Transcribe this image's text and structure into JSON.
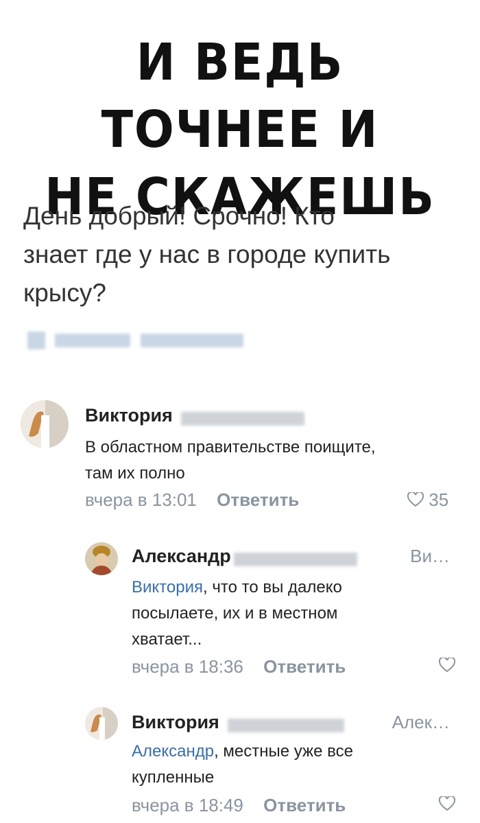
{
  "headline": {
    "line1": "И ВЕДЬ ТОЧНЕЕ И",
    "line2": "НЕ СКАЖЕШЬ"
  },
  "post": {
    "text_line1": "День добрый! Срочно! Кто",
    "text_line2": "знает где у нас в городе купить",
    "text_line3": "крысу?"
  },
  "comments": [
    {
      "author": "Виктория",
      "text_line1": "В областном правительстве поищите,",
      "text_line2": "там их полно",
      "time": "вчера в 13:01",
      "reply_label": "Ответить",
      "likes": "35"
    },
    {
      "author": "Александр",
      "reply_to": "Ви…",
      "mention": "Виктория",
      "text_line1_rest": ", что то вы далеко",
      "text_line2": "посылаете, их и в местном",
      "text_line3": "хватает...",
      "time": "вчера в 18:36",
      "reply_label": "Ответить"
    },
    {
      "author": "Виктория",
      "reply_to": "Алек…",
      "mention": "Александр",
      "text_line1_rest": ", местные уже все",
      "text_line2": "купленные",
      "time": "вчера в 18:49",
      "reply_label": "Ответить"
    }
  ],
  "colors": {
    "mention": "#3a6ea8",
    "meta": "#8a94a0",
    "headline": "#111111"
  },
  "icons": {
    "like": "heart-icon"
  }
}
